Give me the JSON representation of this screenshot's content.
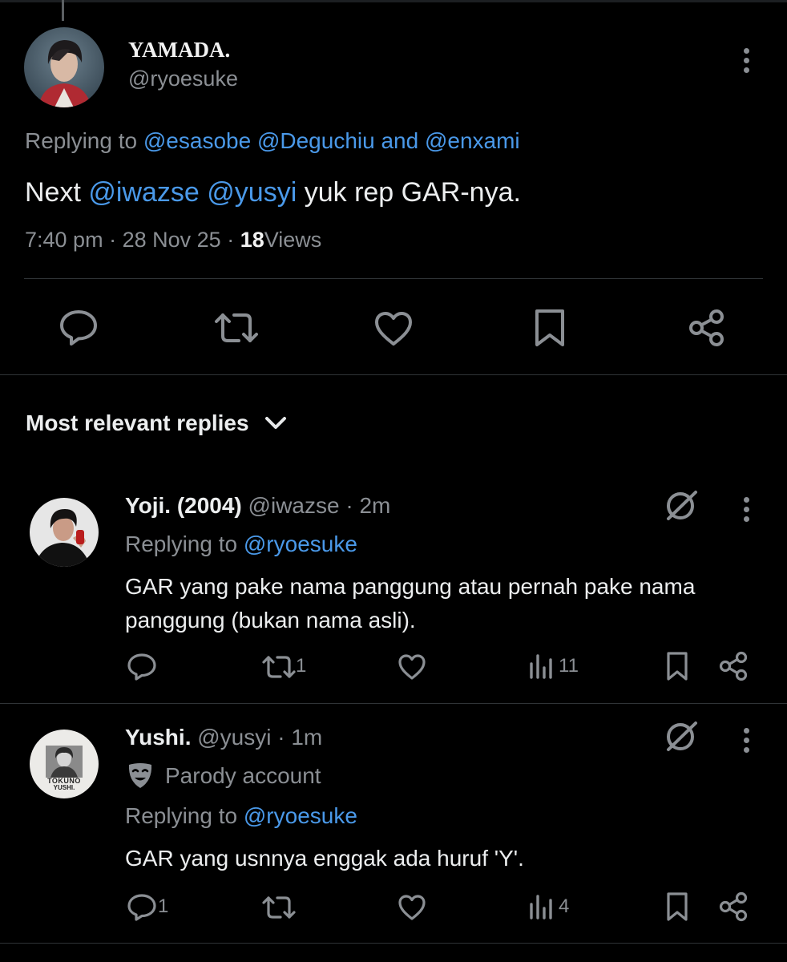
{
  "tweet": {
    "display_name": "YAMADA.",
    "handle": "@ryoesuke",
    "replying_prefix": "Replying to",
    "replying_mention_1": "@esasobe",
    "replying_mention_2": "@Deguchiu",
    "replying_and": "and",
    "replying_mention_3": "@enxami",
    "text_prefix": "Next",
    "text_mention_1": "@iwazse",
    "text_mention_2": "@yusyi",
    "text_suffix": "yuk rep GAR-nya.",
    "time": "7:40 pm",
    "date": "28 Nov 25",
    "views_count": "18",
    "views_label": "Views",
    "separator": "·"
  },
  "replies_header": {
    "label": "Most relevant replies"
  },
  "replies": [
    {
      "display_name": "Yoji. (2004)",
      "handle": "@iwazse",
      "time": "2m",
      "replying_prefix": "Replying to",
      "replying_mention": "@ryoesuke",
      "text_line_1": "GAR yang pake nama panggung atau pernah pake nama",
      "text_line_2": "panggung (bukan nama asli).",
      "reply_count": "",
      "retweet_count": "1",
      "views_count": "11"
    },
    {
      "display_name": "Yushi.",
      "handle": "@yusyi",
      "time": "1m",
      "badge_label": "Parody account",
      "replying_prefix": "Replying to",
      "replying_mention": "@ryoesuke",
      "text_line_1": "GAR yang usnnya enggak ada huruf 'Y'.",
      "reply_count": "1",
      "retweet_count": "",
      "views_count": "4",
      "avatar_text_1": "TOKUNO",
      "avatar_text_2": "YUSHI."
    }
  ],
  "colors": {
    "background": "#000000",
    "text": "#e7e9ea",
    "secondary": "#8b8f94",
    "link": "#4a99e9",
    "divider": "#2f3336"
  }
}
